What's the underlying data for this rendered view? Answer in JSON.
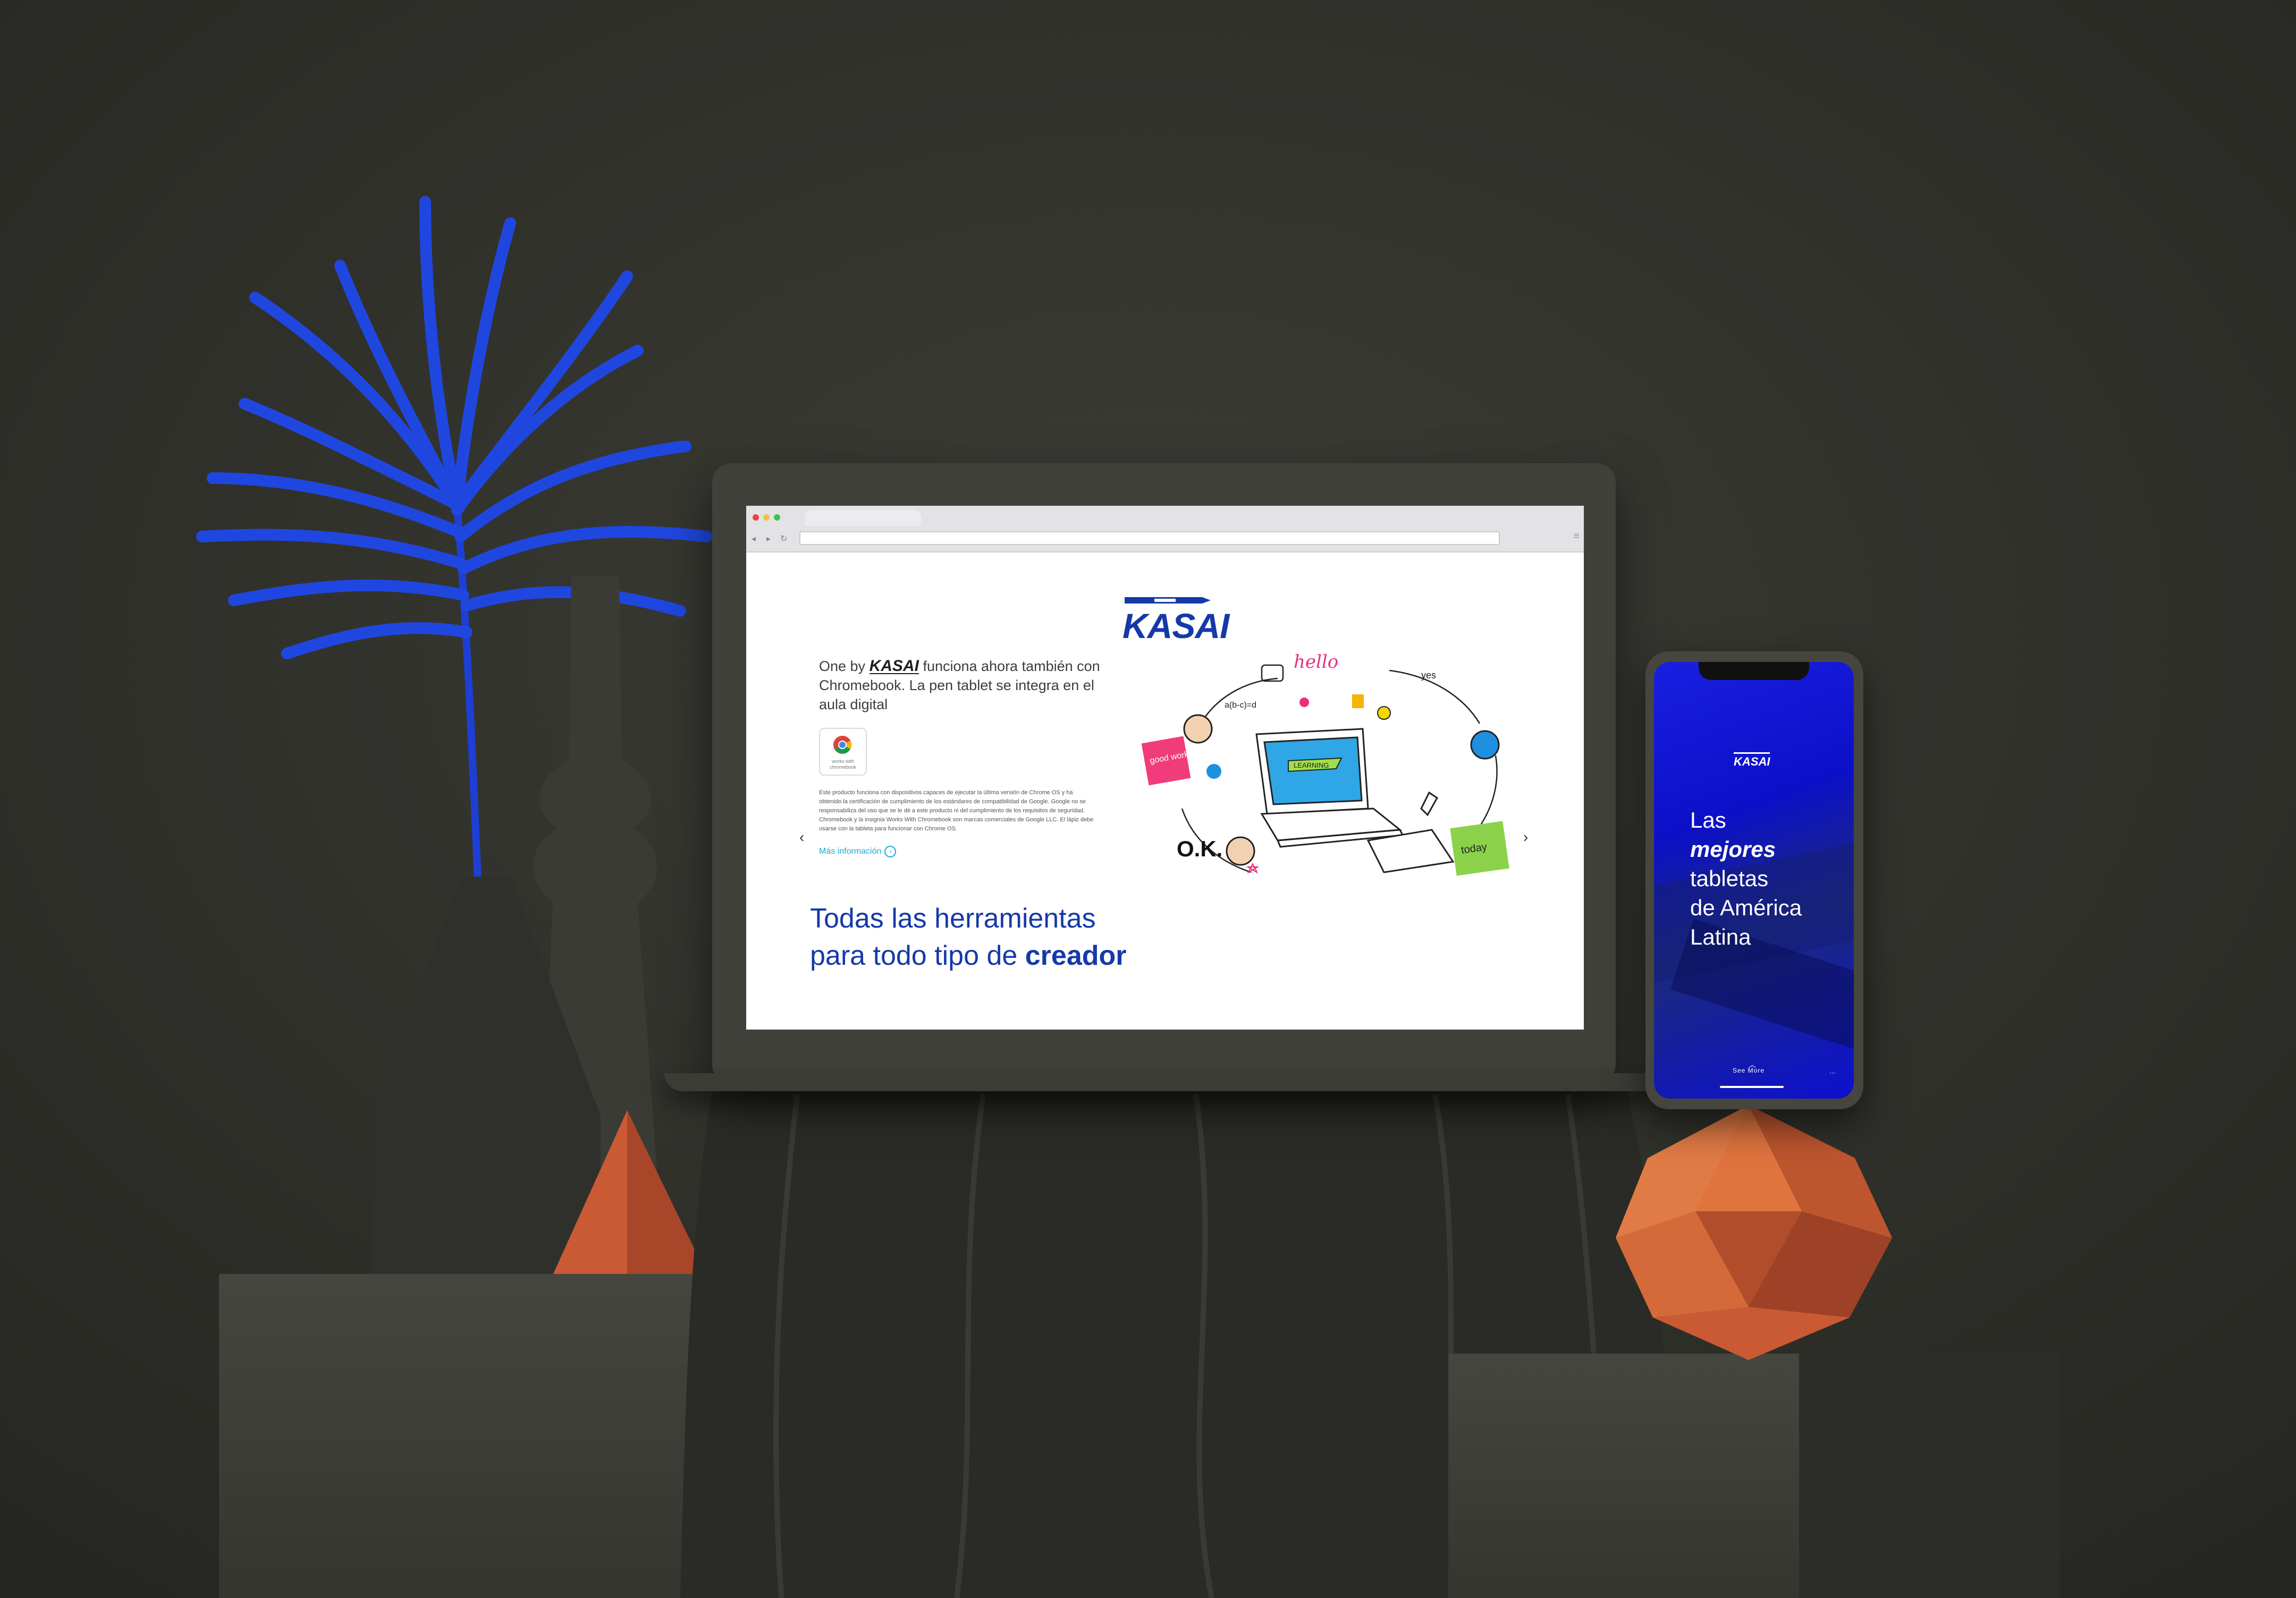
{
  "laptop": {
    "browser": {
      "back_icon": "back-arrow-icon",
      "forward_icon": "forward-arrow-icon",
      "reload_icon": "reload-icon",
      "menu_icon": "menu-icon",
      "address": ""
    },
    "page": {
      "logo": "KASAI",
      "hero_prefix": "One by",
      "hero_logo": "KASAI",
      "hero_suffix": "funciona ahora también con Chromebook. La pen tablet se integra en el aula digital",
      "badge_text": "works with chromebook",
      "disclaimer": "Este producto funciona con dispositivos capaces de ejecutar la última versión de Chrome OS y ha obtenido la certificación de cumplimiento de los estándares de compatibilidad de Google. Google no se responsabiliza del uso que se le dé a este producto ni del cumplimiento de los requisitos de seguridad. Chromebook y la insignia Works With Chromebook son marcas comerciales de Google LLC. El lápiz debe usarse con la tableta para funcionar con Chrome OS.",
      "more_link": "Más información",
      "headline_line1": "Todas las herramientas",
      "headline_line2_prefix": "para todo tipo de",
      "headline_line2_bold": "creador",
      "illustration_words": {
        "hello": "hello",
        "yes": "yes",
        "good_work": "good work",
        "ok": "O.K.",
        "today": "today",
        "math": "a(b-c)=d",
        "learning": "LEARNING"
      }
    }
  },
  "phone": {
    "logo": "KASAI",
    "title_line1": "Las",
    "title_line2": "mejores",
    "title_line3": "tabletas",
    "title_line4": "de América",
    "title_line5": "Latina",
    "see_more": "See More",
    "dots": "···"
  },
  "colors": {
    "brand_blue": "#1539a8",
    "link_cyan": "#1aa8d8",
    "phone_blue": "#1a1fe0",
    "background": "#2f2f2b"
  }
}
